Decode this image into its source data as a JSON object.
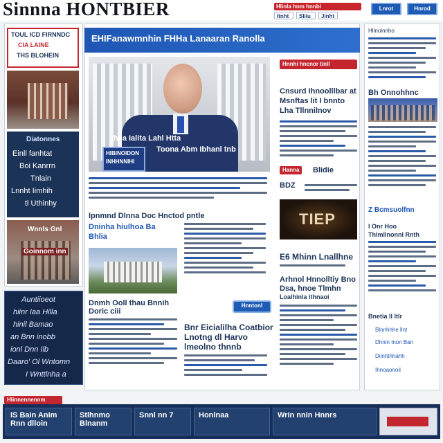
{
  "header": {
    "logo": "Sinnna HONTBIER",
    "links": [
      "Hlinla hnm hnnbi",
      "Itnht",
      "Sliiu",
      "Jinht"
    ],
    "buttons": [
      "Lnrot",
      "Hnrod"
    ]
  },
  "left_column": {
    "promo_title_lines": [
      "TOUL ICD FIRNNDC",
      "CIA LAINE",
      "THS BLOHEIN"
    ],
    "list_heading": "Diatonnes",
    "list_items": [
      "Einll fanhtat",
      "Boi Kanrrn",
      "Tnlain",
      "Lnnht Iimhih",
      "tl Uthinhy"
    ],
    "photo_caption_lines": [
      "Wnnls Gnl",
      "Goinnom inn"
    ],
    "quote_lines": [
      "Auntiioeot",
      "hiinr Iaa Hilla",
      "hinil Bamao",
      "an Bnn inobb",
      "ionl Dnn Ilb",
      "Daaro' Ol Wntomn",
      "I Wnttlnha a"
    ]
  },
  "center": {
    "banner": "EHIFanawmnhin FHHa Lanaaran Ranolla",
    "hero_overlay_lines": [
      "hlia Ialita Lahl Htta",
      "Toona Abm Ibhanl tnb"
    ],
    "hero_tag_lines": [
      "HIBINOIDON",
      "INHHNNIHI"
    ],
    "subhead": "Ipnmnd Dlnna Doc Hnctod pntle",
    "story_title_lines": [
      "Dninha hiulhoa Ba",
      "Bhlia"
    ],
    "second_title_lines": [
      "Dnmh Ooll thau Bnnih",
      "Doric ciii"
    ],
    "bottom_headline_lines": [
      "Bnr Eicialilha Coatbior",
      "Lnotng dl Harvo",
      "lmeolno thnnb"
    ],
    "read_button": "Hnntonl"
  },
  "right_column": {
    "badge": "Hnnhi hncnor tinll",
    "headline_lines": [
      "Cnsurd Ihnoolllbar at",
      "Msnftas lit I bnnto",
      "Lha Tllnnilnov"
    ],
    "section_badge": "Hanna",
    "section_label": "Blidie",
    "small_label": "BDZ",
    "video_label": "TIEP",
    "story_lines": [
      "E6 Mhinn Lnallhne"
    ],
    "story2_lines": [
      "Arhnol Hnnolltiy Bno",
      "Dsa, hnoe Tlmhn",
      "Loalhinla ithnaoi"
    ]
  },
  "far_right": {
    "top_label": "Hllnolnnho",
    "opinion": "Bh Onnohhnc",
    "mid_labels": [
      "Z Bcmsuolfnn",
      "I Onr Hoo",
      "Thlmllnonnl Rnth"
    ],
    "section": "Bnetia ll ltlr",
    "links": [
      "Blnnhhhe llnt",
      "Dhnin Inon Ban",
      "Diinhthhahh",
      "Ihnoaonoil"
    ]
  },
  "footer": {
    "badge": "Hlinnennennm",
    "tiles": [
      "IS Bain Anim Rnn dlloin",
      "Stlhnmo Blnanm",
      "Snnl nn 7",
      "Honlnaa",
      "Wrin nnin Hnnrs"
    ]
  },
  "colors": {
    "navy": "#1c3358",
    "accent_blue": "#1f56b4",
    "accent_red": "#c42630",
    "page_bg": "#f2f3f5"
  }
}
